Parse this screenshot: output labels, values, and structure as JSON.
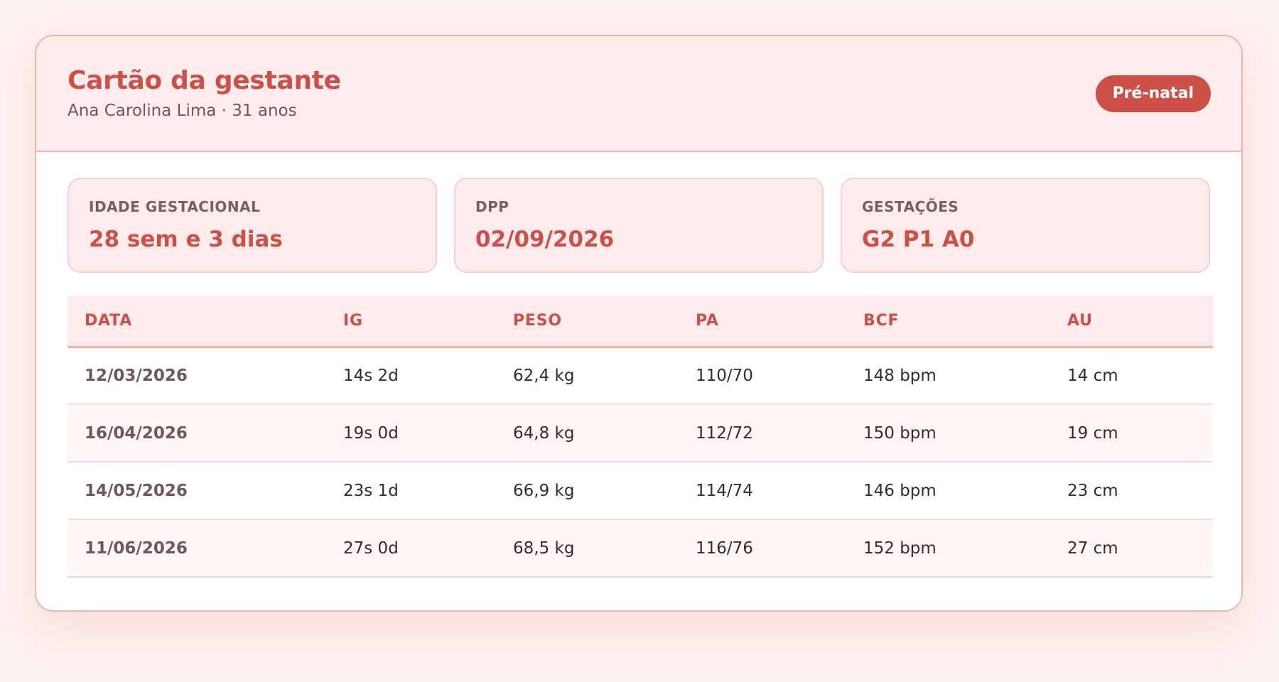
{
  "header": {
    "title": "Cartão da gestante",
    "subtitle": "Ana Carolina Lima · 31 anos",
    "badge": "Pré-natal"
  },
  "stats": [
    {
      "label": "IDADE GESTACIONAL",
      "value": "28 sem e 3 dias"
    },
    {
      "label": "DPP",
      "value": "02/09/2026"
    },
    {
      "label": "GESTAÇÕES",
      "value": "G2 P1 A0"
    }
  ],
  "table": {
    "columns": [
      "DATA",
      "IG",
      "PESO",
      "PA",
      "BCF",
      "AU"
    ],
    "rows": [
      [
        "12/03/2026",
        "14s 2d",
        "62,4 kg",
        "110/70",
        "148 bpm",
        "14 cm"
      ],
      [
        "16/04/2026",
        "19s 0d",
        "64,8 kg",
        "112/72",
        "150 bpm",
        "19 cm"
      ],
      [
        "14/05/2026",
        "23s 1d",
        "66,9 kg",
        "114/74",
        "146 bpm",
        "23 cm"
      ],
      [
        "11/06/2026",
        "27s 0d",
        "68,5 kg",
        "116/76",
        "152 bpm",
        "27 cm"
      ]
    ]
  },
  "colors": {
    "accent": "#cd5048",
    "header_bg": "#fdeceb",
    "border": "#f4b3aa",
    "page_bg": "#fdf1ef"
  }
}
